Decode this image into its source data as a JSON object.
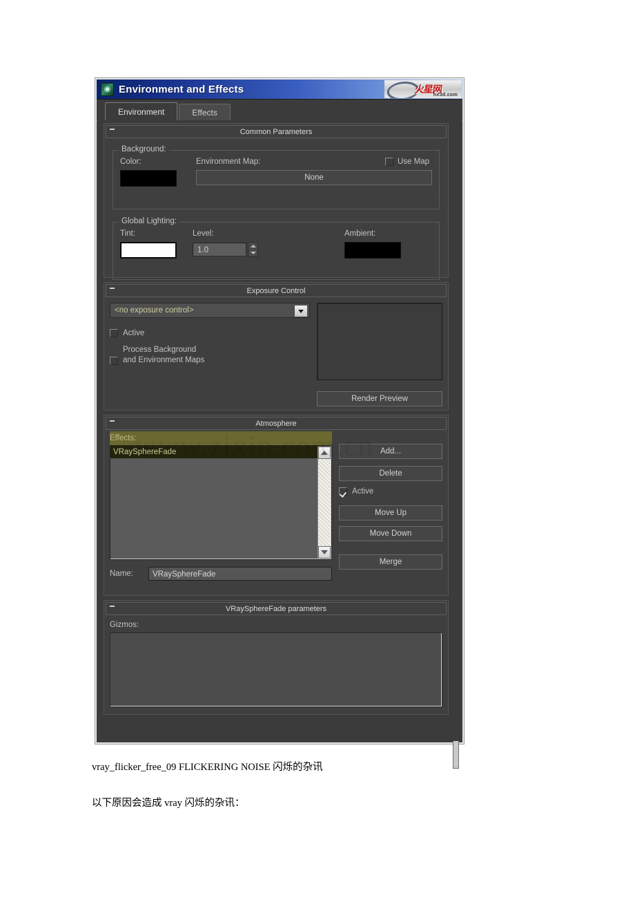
{
  "window": {
    "title": "Environment and Effects",
    "icon": "environment-effects-icon",
    "logo_text": "火星网",
    "logo_subtext": "hx3d.com"
  },
  "tabs": [
    {
      "label": "Environment",
      "active": true
    },
    {
      "label": "Effects",
      "active": false
    }
  ],
  "rollouts": {
    "common_parameters": {
      "title": "Common Parameters",
      "background": {
        "group_label": "Background:",
        "color_label": "Color:",
        "color_value": "#000000",
        "environment_map_label": "Environment Map:",
        "map_button_label": "None",
        "use_map_label": "Use Map",
        "use_map_checked": false
      },
      "global_lighting": {
        "group_label": "Global Lighting:",
        "tint_label": "Tint:",
        "tint_value": "#ffffff",
        "level_label": "Level:",
        "level_value": "1.0",
        "ambient_label": "Ambient:",
        "ambient_value": "#000000"
      }
    },
    "exposure_control": {
      "title": "Exposure Control",
      "selected_option": "<no exposure control>",
      "options": [
        "<no exposure control>"
      ],
      "active_label": "Active",
      "active_checked": false,
      "process_bg_label_line1": "Process Background",
      "process_bg_label_line2": "and Environment Maps",
      "process_bg_checked": false,
      "render_preview_label": "Render Preview"
    },
    "atmosphere": {
      "title": "Atmosphere",
      "effects_label": "Effects:",
      "effects_items": [
        "VRaySphereFade"
      ],
      "selected_effect": "VRaySphereFade",
      "buttons": {
        "add": "Add...",
        "delete": "Delete",
        "move_up": "Move Up",
        "move_down": "Move Down",
        "merge": "Merge"
      },
      "active_label": "Active",
      "active_checked": true,
      "name_label": "Name:",
      "name_value": "VRaySphereFade"
    },
    "vray_sphere_fade": {
      "title": "VRaySphereFade parameters",
      "gizmos_label": "Gizmos:",
      "gizmos_items": []
    }
  },
  "watermark": "www.zixin.com.cn",
  "captions": {
    "line1": "vray_flicker_free_09 FLICKERING NOISE 闪烁的杂讯",
    "line2": "以下原因会造成 vray 闪烁的杂讯："
  }
}
